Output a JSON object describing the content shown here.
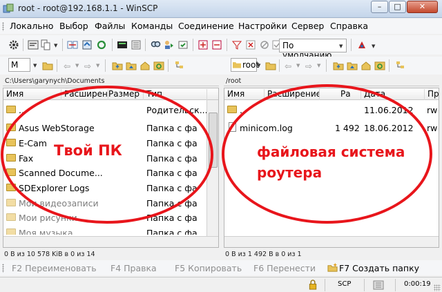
{
  "window": {
    "title": "root - root@192.168.1.1 - WinSCP",
    "min_glyph": "–",
    "max_glyph": "□",
    "close_glyph": "✕"
  },
  "menu": [
    "Локально",
    "Выбор",
    "Файлы",
    "Команды",
    "Соединение",
    "Настройки",
    "Сервер",
    "Справка"
  ],
  "toolbar": {
    "transfer_settings": "По умолчанию"
  },
  "left": {
    "drive": "M",
    "path": "C:\\Users\\garynych\\Documents",
    "columns": [
      "Имя",
      "Расширени",
      "Размер",
      "Тип"
    ],
    "rows": [
      {
        "name": "..",
        "type": "Родительск...",
        "dim": false
      },
      {
        "name": "Asus WebStorage",
        "type": "Папка с фа",
        "dim": false
      },
      {
        "name": "E-Cam",
        "type": "Папка с фа",
        "dim": false
      },
      {
        "name": "Fax",
        "type": "Папка с фа",
        "dim": false
      },
      {
        "name": "Scanned Docume...",
        "type": "Папка с фа",
        "dim": false
      },
      {
        "name": "SDExplorer Logs",
        "type": "Папка с фа",
        "dim": false
      },
      {
        "name": "Мои видеозаписи",
        "type": "Папка с фа",
        "dim": true
      },
      {
        "name": "Мои рисунки",
        "type": "Папка с фа",
        "dim": true
      },
      {
        "name": "Моя музыка",
        "type": "Папка с фа",
        "dim": true
      }
    ],
    "status": "0 B из 10 578 KiB в 0 из 14",
    "annotation": "Твой ПК"
  },
  "right": {
    "dir": "root",
    "path": "/root",
    "columns": [
      "Имя",
      "Расширение",
      "Ра",
      "Дата",
      "Пр"
    ],
    "rows": [
      {
        "name": "..",
        "size": "",
        "date": "11.06.2012",
        "rights": "rw"
      },
      {
        "name": "minicom.log",
        "size": "1 492",
        "date": "18.06.2012",
        "rights": "rw"
      }
    ],
    "status": "0 B из 1 492 B в 0 из 1",
    "annotation_line1": "файловая система",
    "annotation_line2": "роутера"
  },
  "fkeys": [
    {
      "label": "F2 Переименовать",
      "active": false
    },
    {
      "label": "F4 Правка",
      "active": false
    },
    {
      "label": "F5 Копировать",
      "active": false
    },
    {
      "label": "F6 Перенести",
      "active": false
    },
    {
      "label": "F7 Создать папку",
      "active": true
    }
  ],
  "statusbar": {
    "protocol": "SCP",
    "time": "0:00:19"
  },
  "colors": {
    "annotation": "#e8151b",
    "folder": "#e8c35a"
  }
}
